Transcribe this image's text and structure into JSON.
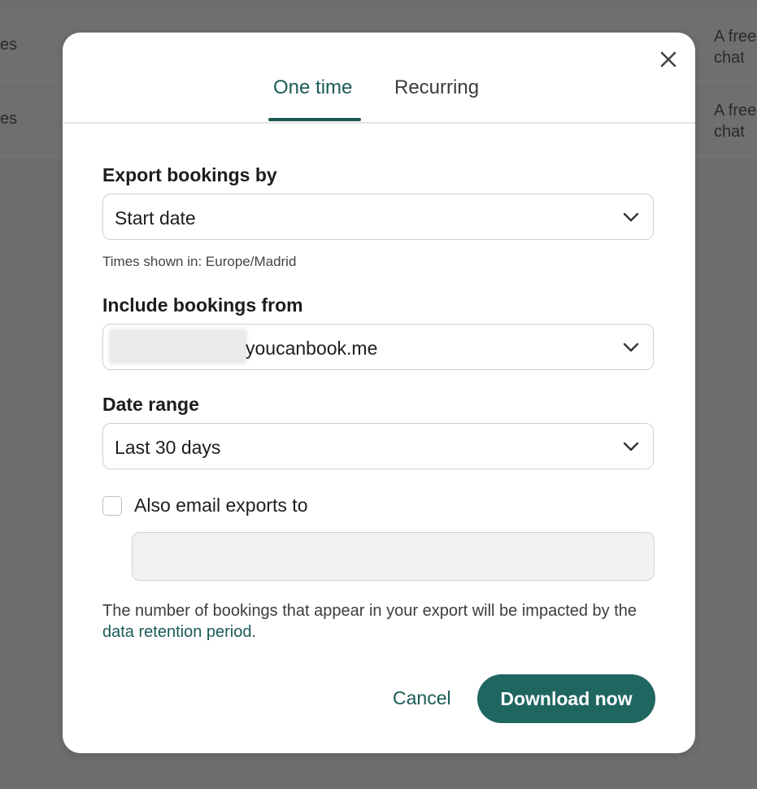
{
  "background": {
    "rows": [
      {
        "left_text": "es",
        "right_text": "A free\nchat"
      },
      {
        "left_text": "es",
        "right_text": "A free\nchat"
      }
    ]
  },
  "modal": {
    "tabs": [
      {
        "label": "One time",
        "active": true
      },
      {
        "label": "Recurring",
        "active": false
      }
    ],
    "export_by": {
      "label": "Export bookings by",
      "value": "Start date",
      "hint": "Times shown in: Europe/Madrid"
    },
    "include_from": {
      "label": "Include bookings from",
      "value": "youcanbook.me"
    },
    "date_range": {
      "label": "Date range",
      "value": "Last 30 days"
    },
    "email_export": {
      "label": "Also email exports to",
      "checked": false,
      "value": ""
    },
    "note": {
      "text": "The number of bookings that appear in your export will be impacted by the ",
      "link": "data retention period",
      "suffix": "."
    },
    "actions": {
      "cancel": "Cancel",
      "download": "Download now"
    }
  },
  "colors": {
    "accent": "#1a5b55",
    "primary_button": "#1f6661",
    "overlay": "#6e6e6c"
  }
}
